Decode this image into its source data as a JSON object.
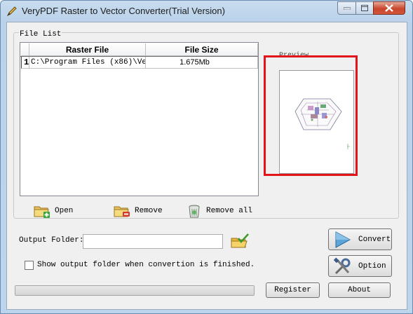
{
  "window": {
    "title": "VeryPDF Raster to Vector Converter(Trial Version)",
    "controls": [
      "minimize",
      "maximize",
      "close"
    ]
  },
  "file_list": {
    "group_title": "File List",
    "columns": [
      "",
      "Raster File",
      "File Size"
    ],
    "rows": [
      {
        "index": "1",
        "raster_file": "C:\\Program Files (x86)\\Ve…",
        "file_size": "1.675Mb"
      }
    ]
  },
  "preview": {
    "label": "Preview",
    "highlight_color": "#e0161b"
  },
  "actions": {
    "open_label": "Open",
    "remove_label": "Remove",
    "remove_all_label": "Remove all"
  },
  "output": {
    "label": "Output Folder:",
    "value": "",
    "show_folder_checkbox_label": "Show output folder when convertion is finished.",
    "show_folder_checked": false
  },
  "buttons": {
    "convert_label": "Convert",
    "option_label": "Option",
    "register_label": "Register",
    "about_label": "About"
  },
  "progress": {
    "fraction": 0
  },
  "icons": {
    "app": "pencil-icon",
    "open": "folder-add-icon",
    "remove": "folder-remove-icon",
    "remove_all": "trash-icon",
    "browse": "folder-check-icon",
    "convert": "play-arrow-icon",
    "option": "tools-icon"
  }
}
